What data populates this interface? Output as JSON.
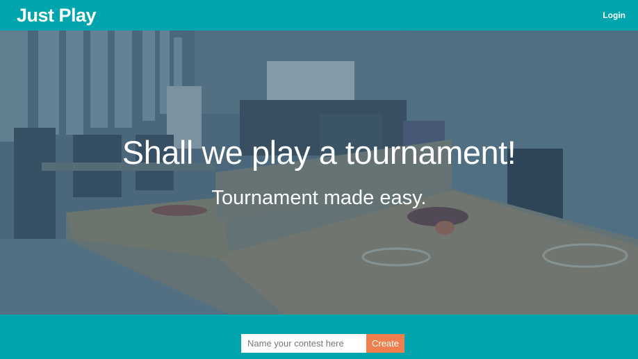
{
  "navbar": {
    "brand": "Just Play",
    "login_label": "Login"
  },
  "hero": {
    "title": "Shall we play a tournament!",
    "subtitle": "Tournament made easy."
  },
  "create_form": {
    "placeholder": "Name your contest here",
    "value": "",
    "create_label": "Create"
  },
  "colors": {
    "brand_teal": "#00a5ad",
    "create_orange": "#ef7f4c"
  }
}
